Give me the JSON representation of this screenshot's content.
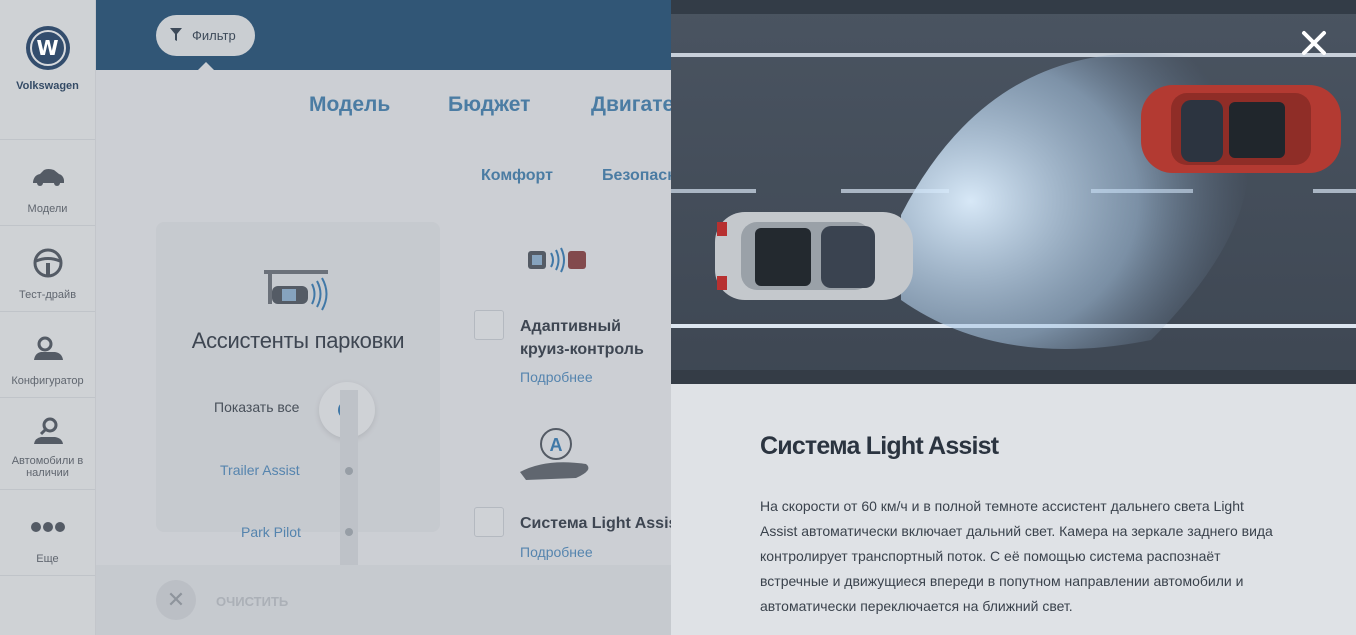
{
  "sidebar": {
    "brand": "Volkswagen",
    "logo_letter": "W",
    "items": [
      {
        "label": "Модели",
        "icon": "car-icon"
      },
      {
        "label": "Тест-драйв",
        "icon": "steering-wheel-icon"
      },
      {
        "label": "Конфигуратор",
        "icon": "car-gear-icon"
      },
      {
        "label": "Автомобили в наличии",
        "icon": "car-search-icon"
      },
      {
        "label": "Еще",
        "icon": "more-dots-icon"
      }
    ]
  },
  "toolbar": {
    "filter_label": "Фильтр"
  },
  "tabs": [
    {
      "label": "Модель"
    },
    {
      "label": "Бюджет"
    },
    {
      "label": "Двигатель"
    }
  ],
  "subtabs": [
    {
      "label": "Комфорт"
    },
    {
      "label": "Безопасность"
    }
  ],
  "parking_card": {
    "title": "Ассистенты парковки",
    "show_all": "Показать все",
    "options": [
      "Trailer Assist",
      "Park Pilot"
    ]
  },
  "features": [
    {
      "title": "Адаптивный круиз-контроль",
      "more": "Подробнее"
    },
    {
      "title": "Система Light Assist",
      "more": "Подробнее"
    }
  ],
  "bottom": {
    "clear_label": "ОЧИСТИТЬ"
  },
  "modal": {
    "title": "Система Light Assist",
    "description": "На скорости от 60 км/ч и в полной темноте ассистент дальнего света Light Assist автоматически включает дальний свет. Камера на зеркале заднего вида контролирует транспортный поток. С её помощью система распознаёт встречные и движущиеся впереди в попутном направлении автомобили и автоматически переключается на ближний свет."
  },
  "colors": {
    "accent": "#3d7fb1",
    "topbar": "#1a4a72",
    "toggle_dot": "#2f79b6"
  }
}
